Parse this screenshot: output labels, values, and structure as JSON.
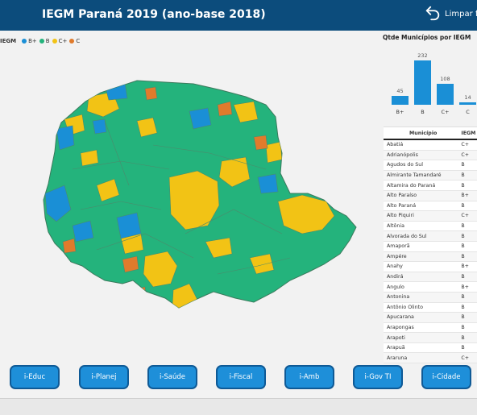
{
  "header": {
    "title": "IEGM Paraná 2019 (ano-base 2018)",
    "reset_label": "Limpar filt"
  },
  "legend": {
    "title": "IEGM",
    "items": [
      {
        "label": "B+",
        "color": "#1a8fd6"
      },
      {
        "label": "B",
        "color": "#24b37c"
      },
      {
        "label": "C+",
        "color": "#f2c315"
      },
      {
        "label": "C",
        "color": "#e07b2c"
      }
    ]
  },
  "chart_data": {
    "type": "bar",
    "title": "Qtde Municípios por IEGM",
    "categories": [
      "B+",
      "B",
      "C+",
      "C"
    ],
    "values": [
      45,
      232,
      108,
      14
    ],
    "value_labels": [
      "45",
      "232",
      "108",
      "14"
    ],
    "color": "#1a8fd6"
  },
  "table": {
    "headers": [
      "Município",
      "IEGM"
    ],
    "rows": [
      [
        "Abatiá",
        "C+"
      ],
      [
        "Adrianópolis",
        "C+"
      ],
      [
        "Agudos do Sul",
        "B"
      ],
      [
        "Almirante Tamandaré",
        "B"
      ],
      [
        "Altamira do Paraná",
        "B"
      ],
      [
        "Alto Paraíso",
        "B+"
      ],
      [
        "Alto Paraná",
        "B"
      ],
      [
        "Alto Piquiri",
        "C+"
      ],
      [
        "Altônia",
        "B"
      ],
      [
        "Alvorada do Sul",
        "B"
      ],
      [
        "Amaporã",
        "B"
      ],
      [
        "Ampére",
        "B"
      ],
      [
        "Anahy",
        "B+"
      ],
      [
        "Andirá",
        "B"
      ],
      [
        "Ângulo",
        "B+"
      ],
      [
        "Antonina",
        "B"
      ],
      [
        "Antônio Olinto",
        "B"
      ],
      [
        "Apucarana",
        "B"
      ],
      [
        "Arapongas",
        "B"
      ],
      [
        "Arapoti",
        "B"
      ],
      [
        "Arapuã",
        "B"
      ],
      [
        "Araruna",
        "C+"
      ]
    ]
  },
  "nav": {
    "buttons": [
      "i-Educ",
      "i-Planej",
      "i-Saúde",
      "i-Fiscal",
      "i-Amb",
      "i-Gov TI",
      "i-Cidade"
    ]
  }
}
